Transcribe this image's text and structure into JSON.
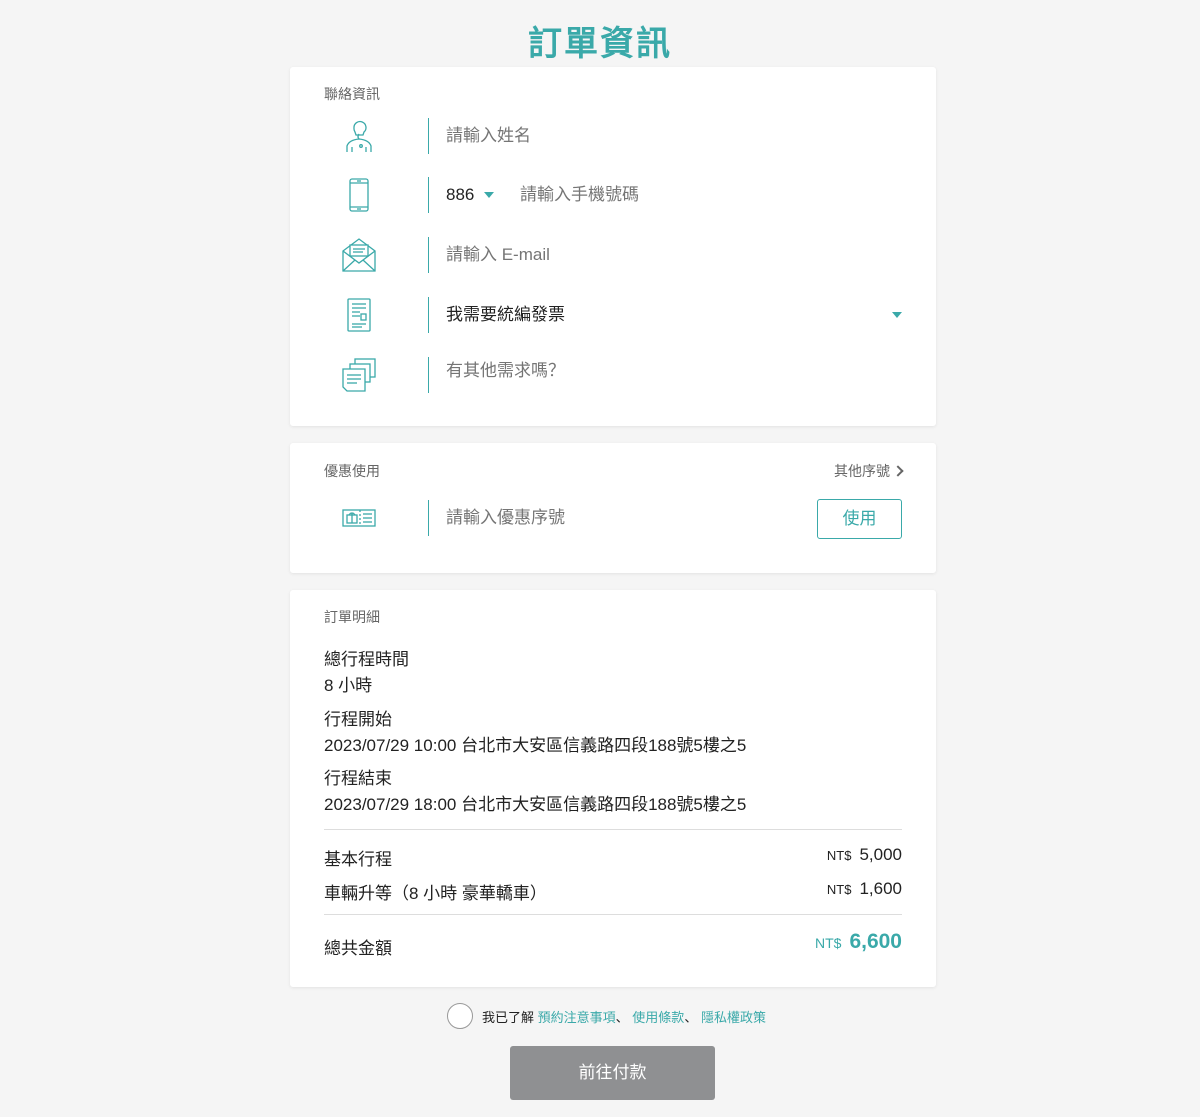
{
  "title": "訂單資訊",
  "contact": {
    "section_label": "聯絡資訊",
    "name_placeholder": "請輸入姓名",
    "country_code": "886",
    "phone_placeholder": "請輸入手機號碼",
    "email_placeholder": "請輸入 E-mail",
    "invoice_selected": "我需要統編發票",
    "notes_placeholder": "有其他需求嗎？"
  },
  "coupon": {
    "section_label": "優惠使用",
    "more_codes_label": "其他序號",
    "code_placeholder": "請輸入優惠序號",
    "apply_label": "使用"
  },
  "order": {
    "section_label": "訂單明細",
    "duration_label": "總行程時間",
    "duration_value": "8 小時",
    "start_label": "行程開始",
    "start_value": "2023/07/29 10:00 台北市大安區信義路四段188號5樓之5",
    "end_label": "行程結束",
    "end_value": "2023/07/29 18:00 台北市大安區信義路四段188號5樓之5",
    "items": [
      {
        "name": "基本行程",
        "currency": "NT$",
        "amount": "5,000"
      },
      {
        "name": "車輛升等（8 小時 豪華轎車）",
        "currency": "NT$",
        "amount": "1,600"
      }
    ],
    "total_label": "總共金額",
    "total_currency": "NT$",
    "total_amount": "6,600"
  },
  "agreement": {
    "prefix": "我已了解",
    "link1": "預約注意事項",
    "sep1": "、",
    "link2": "使用條款",
    "sep2": "、",
    "link3": "隱私權政策"
  },
  "pay_label": "前往付款",
  "colors": {
    "accent": "#3aa9a9",
    "button_disabled": "#8f9092",
    "background": "#f5f5f5"
  }
}
